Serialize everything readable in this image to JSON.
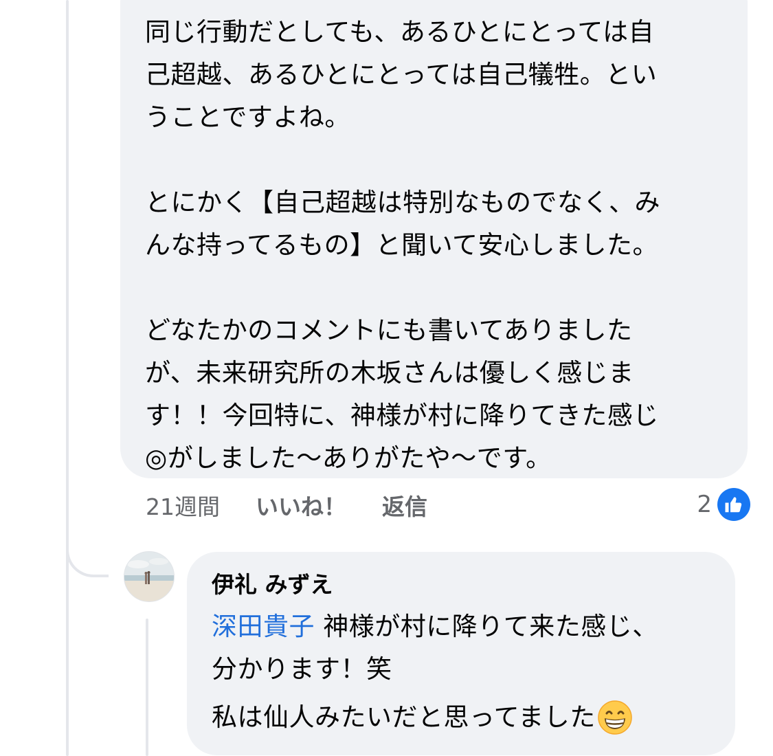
{
  "comment": {
    "text": "同じ行動だとしても、あるひとにとっては自\n己超越、あるひとにとっては自己犠牲。とい\nうことですよね。\n\nとにかく【自己超越は特別なものでなく、み\nんな持ってるもの】と聞いて安心しました。\n\nどなたかのコメントにも書いてありました\nが、未来研究所の木坂さんは優しく感じま\nす！！今回特に、神様が村に降りてきた感じ\n◎がしました〜ありがたや〜です。",
    "time": "21週間",
    "like_label": "いいね！",
    "reply_label": "返信",
    "reaction_count": "2",
    "reaction_icon": "thumbs-up-icon",
    "accent_color": "#1877f2"
  },
  "reply": {
    "author": "伊礼 みずえ",
    "mention": "深田貴子",
    "text_line1": " 神様が村に降りて来た感じ、",
    "text_line2": "分かります！笑",
    "text_line3": "私は仙人みたいだと思ってました",
    "emoji": "grinning-face-emoji",
    "mention_color": "#216fdb"
  }
}
